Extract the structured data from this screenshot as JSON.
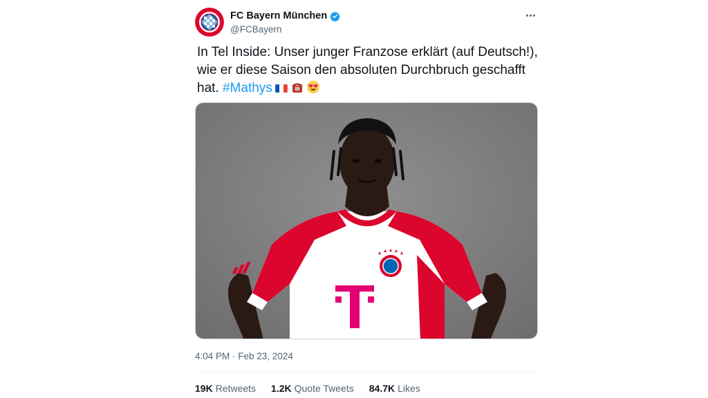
{
  "author": {
    "display_name": "FC Bayern München",
    "handle": "@FCBayern",
    "verified": true,
    "avatar_icon": "fc-bayern-logo-icon"
  },
  "tweet": {
    "line1": "In Tel Inside: Unser junger Franzose erklärt (auf Deutsch!),",
    "line2": "wie er diese Saison den absoluten Durchbruch geschafft",
    "line3_prefix": "hat. ",
    "hashtag": "#Mathys",
    "emojis": [
      "french-flag-icon",
      "telephone-icon",
      "heart-eyes-emoji-icon"
    ]
  },
  "media": {
    "description_icon": "player-photo"
  },
  "meta": {
    "timestamp": "4:04 PM · Feb 23, 2024"
  },
  "stats": [
    {
      "count": "19K",
      "label": "Retweets"
    },
    {
      "count": "1.2K",
      "label": "Quote Tweets"
    },
    {
      "count": "84.7K",
      "label": "Likes"
    }
  ],
  "colors": {
    "link": "#1d9bf0",
    "bayern_red": "#dc052d",
    "secondary_text": "#536471"
  }
}
